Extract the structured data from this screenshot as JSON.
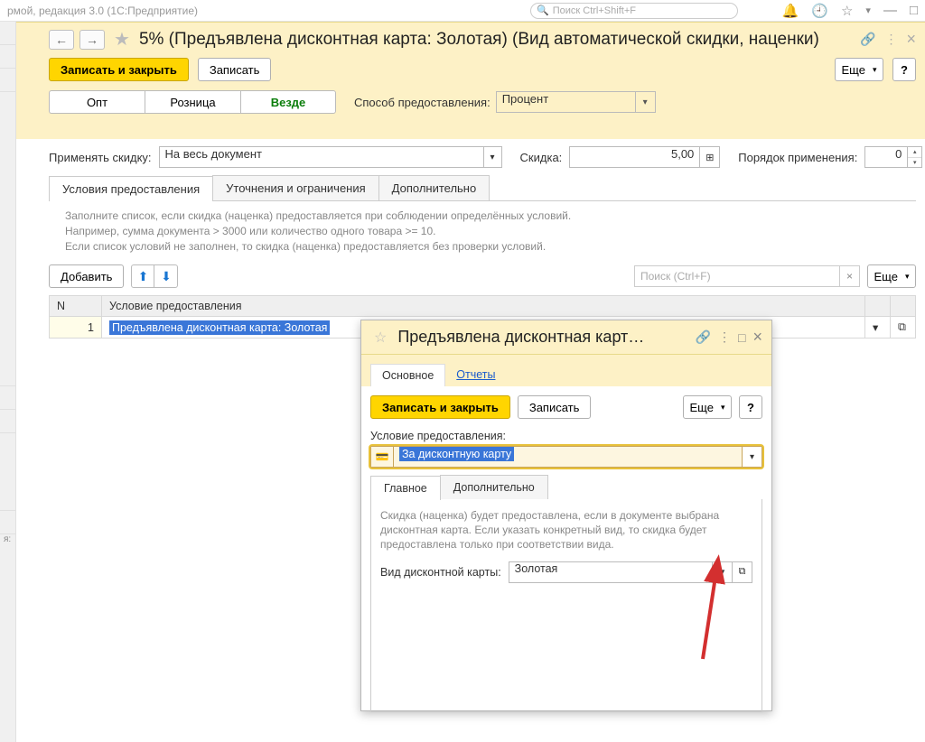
{
  "app_bar": {
    "title_fragment": "рмой, редакция 3.0   (1С:Предприятие)",
    "search_placeholder": "Поиск Ctrl+Shift+F"
  },
  "header": {
    "title": "5% (Предъявлена дисконтная карта: Золотая) (Вид автоматической скидки, наценки)"
  },
  "toolbar": {
    "save_close": "Записать и закрыть",
    "save": "Записать",
    "more": "Еще",
    "help": "?"
  },
  "segments": {
    "opt": "Опт",
    "retail": "Розница",
    "everywhere": "Везде"
  },
  "method": {
    "label": "Способ предоставления:",
    "value": "Процент"
  },
  "params": {
    "apply_label": "Применять скидку:",
    "apply_value": "На весь документ",
    "discount_label": "Скидка:",
    "discount_value": "5,00",
    "order_label": "Порядок применения:",
    "order_value": "0"
  },
  "tabs": {
    "t1": "Условия предоставления",
    "t2": "Уточнения и ограничения",
    "t3": "Дополнительно"
  },
  "hint": {
    "l1": "Заполните список, если скидка (наценка) предоставляется при соблюдении определённых условий.",
    "l2": "Например, сумма документа > 3000 или количество одного товара >= 10.",
    "l3": "Если список условий не заполнен, то скидка (наценка) предоставляется без проверки условий."
  },
  "list_toolbar": {
    "add": "Добавить",
    "search_placeholder": "Поиск (Ctrl+F)",
    "more": "Еще"
  },
  "table": {
    "col_n": "N",
    "col_cond": "Условие предоставления",
    "row1_n": "1",
    "row1_cond": "Предъявлена дисконтная карта: Золотая"
  },
  "popup": {
    "title": "Предъявлена дисконтная карт…",
    "subtabs": {
      "main": "Основное",
      "reports": "Отчеты"
    },
    "toolbar": {
      "save_close": "Записать и закрыть",
      "save": "Записать",
      "more": "Еще",
      "help": "?"
    },
    "condition_label": "Условие предоставления:",
    "condition_value": "За дисконтную карту",
    "tabs": {
      "main": "Главное",
      "extra": "Дополнительно"
    },
    "body_hint": "Скидка (наценка) будет предоставлена, если в документе выбрана дисконтная карта. Если указать конкретный вид, то скидка будет предоставлена только при соответствии вида.",
    "card_type_label": "Вид дисконтной карты:",
    "card_type_value": "Золотая"
  }
}
